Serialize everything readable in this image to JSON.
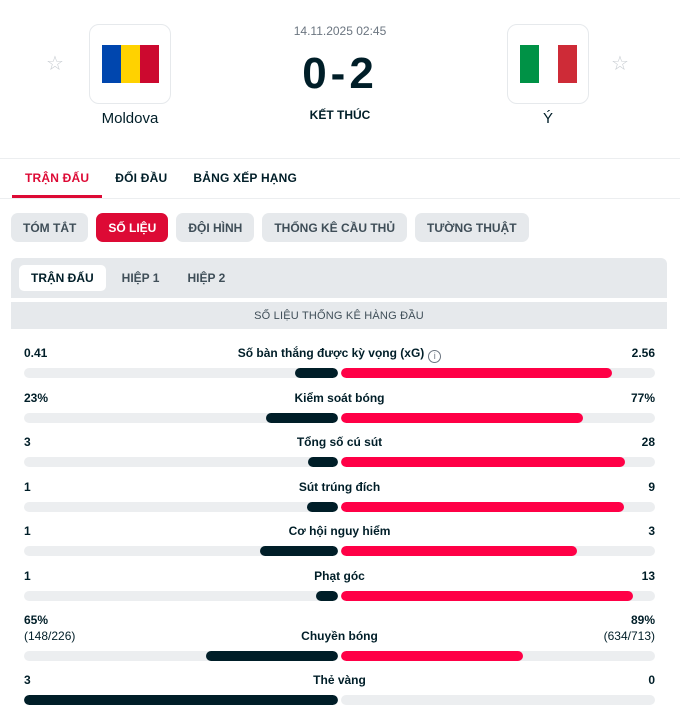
{
  "match": {
    "datetime": "14.11.2025 02:45",
    "score": "0-2",
    "status": "KẾT THÚC",
    "home": {
      "name": "Moldova",
      "flag_colors": [
        "#0046ae",
        "#ffd200",
        "#cc092f"
      ]
    },
    "away": {
      "name": "Ý",
      "flag_colors": [
        "#009246",
        "#ffffff",
        "#ce2b37"
      ]
    }
  },
  "icons": {
    "favorite": "star-icon",
    "info": "info-icon"
  },
  "colors": {
    "accent": "#dd0a35",
    "home_bar": "#001e28",
    "away_bar": "#ff0046",
    "track": "#eceef0"
  },
  "main_tabs": [
    {
      "label": "TRẬN ĐẤU",
      "active": true
    },
    {
      "label": "ĐỐI ĐẦU",
      "active": false
    },
    {
      "label": "BẢNG XẾP HẠNG",
      "active": false
    }
  ],
  "sub_tabs": [
    {
      "label": "TÓM TẮT",
      "active": false
    },
    {
      "label": "SỐ LIỆU",
      "active": true
    },
    {
      "label": "ĐỘI HÌNH",
      "active": false
    },
    {
      "label": "THỐNG KÊ CẦU THỦ",
      "active": false
    },
    {
      "label": "TƯỜNG THUẬT",
      "active": false
    }
  ],
  "periods": [
    {
      "label": "TRẬN ĐẤU",
      "active": true
    },
    {
      "label": "HIỆP 1",
      "active": false
    },
    {
      "label": "HIỆP 2",
      "active": false
    }
  ],
  "section_title": "SỐ LIỆU THỐNG KÊ HÀNG ĐẦU",
  "stats": [
    {
      "name": "Số bàn thắng được kỳ vọng (xG)",
      "home": "0.41",
      "away": "2.56",
      "home_share": 0.138,
      "away_share": 0.862,
      "info": true
    },
    {
      "name": "Kiểm soát bóng",
      "home": "23%",
      "away": "77%",
      "home_share": 0.23,
      "away_share": 0.77
    },
    {
      "name": "Tổng số cú sút",
      "home": "3",
      "away": "28",
      "home_share": 0.097,
      "away_share": 0.903
    },
    {
      "name": "Sút trúng đích",
      "home": "1",
      "away": "9",
      "home_share": 0.1,
      "away_share": 0.9
    },
    {
      "name": "Cơ hội nguy hiểm",
      "home": "1",
      "away": "3",
      "home_share": 0.25,
      "away_share": 0.75
    },
    {
      "name": "Phạt góc",
      "home": "1",
      "away": "13",
      "home_share": 0.071,
      "away_share": 0.929
    },
    {
      "name": "Chuyền bóng",
      "home": "65%",
      "away": "89%",
      "home_sub": "(148/226)",
      "away_sub": "(634/713)",
      "home_share": 0.42,
      "away_share": 0.58
    },
    {
      "name": "Thẻ vàng",
      "home": "3",
      "away": "0",
      "home_share": 1.0,
      "away_share": 0.0
    }
  ]
}
